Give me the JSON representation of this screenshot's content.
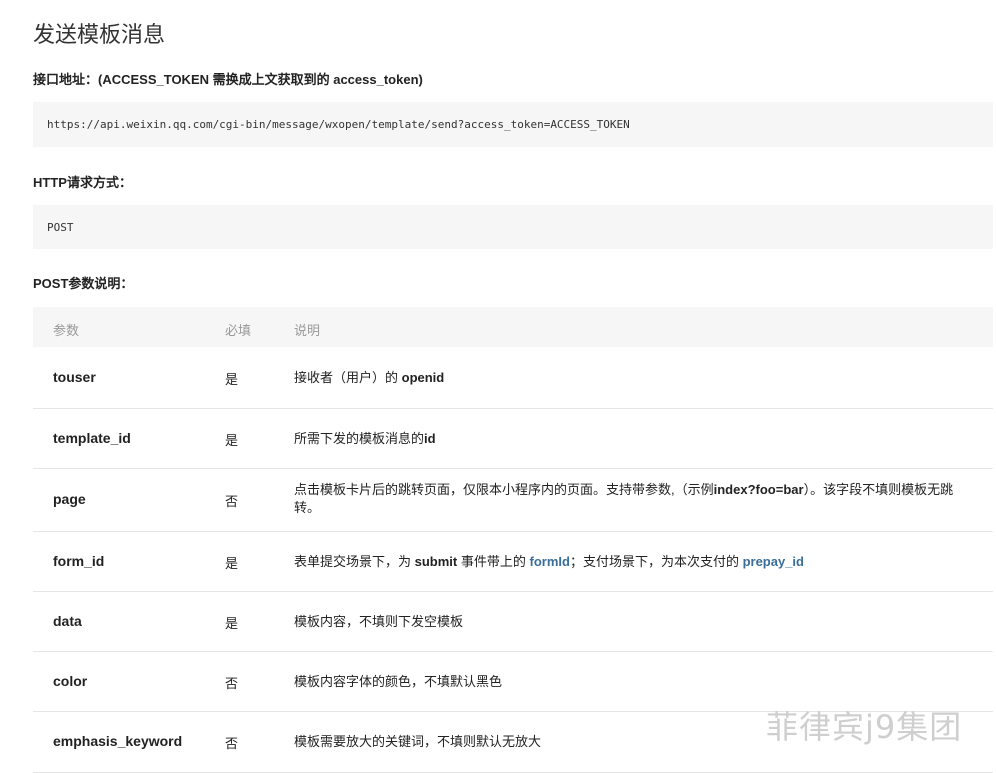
{
  "title": "发送模板消息",
  "endpoint_label": "接口地址：(ACCESS_TOKEN 需换成上文获取到的 access_token)",
  "endpoint_url": "https://api.weixin.qq.com/cgi-bin/message/wxopen/template/send?access_token=ACCESS_TOKEN",
  "method_label": "HTTP请求方式：",
  "method_value": "POST",
  "params_label": "POST参数说明：",
  "table": {
    "headers": [
      "参数",
      "必填",
      "说明"
    ],
    "rows": [
      {
        "param": "touser",
        "required": "是",
        "desc": [
          {
            "t": "接收者（用户）的 "
          },
          {
            "t": "openid",
            "s": "b"
          }
        ]
      },
      {
        "param": "template_id",
        "required": "是",
        "desc": [
          {
            "t": "所需下发的模板消息的"
          },
          {
            "t": "id",
            "s": "b"
          }
        ]
      },
      {
        "param": "page",
        "required": "否",
        "desc": [
          {
            "t": "点击模板卡片后的跳转页面，仅限本小程序内的页面。支持带参数,（示例"
          },
          {
            "t": "index?foo=bar",
            "s": "b"
          },
          {
            "t": "）。该字段不填则模板无跳转。"
          }
        ]
      },
      {
        "param": "form_id",
        "required": "是",
        "desc": [
          {
            "t": "表单提交场景下，为 "
          },
          {
            "t": "submit",
            "s": "b"
          },
          {
            "t": " 事件带上的 "
          },
          {
            "t": "formId",
            "s": "lnk"
          },
          {
            "t": "；支付场景下，为本次支付的 "
          },
          {
            "t": "prepay_id",
            "s": "lnk"
          }
        ]
      },
      {
        "param": "data",
        "required": "是",
        "desc": [
          {
            "t": "模板内容，不填则下发空模板"
          }
        ]
      },
      {
        "param": "color",
        "required": "否",
        "desc": [
          {
            "t": "模板内容字体的颜色，不填默认黑色"
          }
        ]
      },
      {
        "param": "emphasis_keyword",
        "required": "否",
        "desc": [
          {
            "t": "模板需要放大的关键词，不填则默认无放大"
          }
        ]
      }
    ]
  },
  "watermark": "菲律宾j9集团",
  "colors": {
    "code_bg": "#f6f6f6",
    "link": "#3a6d99",
    "header_text": "#999999",
    "row_border": "#e5e5e5"
  }
}
